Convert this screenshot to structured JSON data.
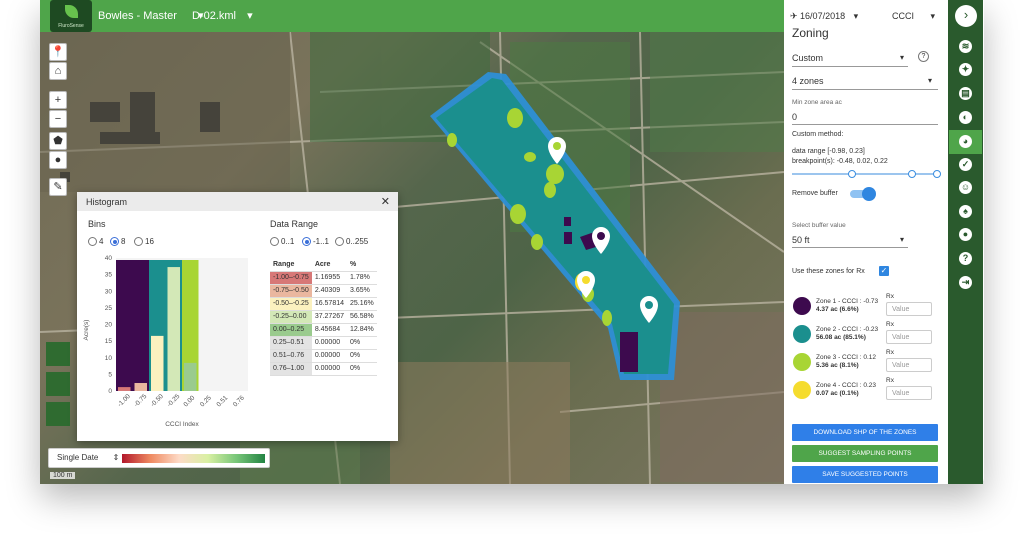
{
  "topbar": {
    "brand": "FluroSense",
    "farm": "Bowles - Master",
    "file": "D-02.kml",
    "farm_caret": "▾",
    "file_caret": "▾"
  },
  "map_controls": {
    "pin": "📍",
    "home": "⌂",
    "zoom_in": "+",
    "zoom_out": "−",
    "polygon": "⬟",
    "circle": "●",
    "cursor": "✎"
  },
  "histogram": {
    "title": "Histogram",
    "close": "✕",
    "bins_label": "Bins",
    "bins_options": [
      "4",
      "8",
      "16"
    ],
    "bins_selected": "8",
    "range_label": "Data Range",
    "range_options": [
      "0..1",
      "-1..1",
      "0..255"
    ],
    "range_selected": "-1..1",
    "y_axis_label": "Acre(s)",
    "x_axis_label": "CCCI Index",
    "y_ticks": [
      "40",
      "35",
      "30",
      "25",
      "20",
      "15",
      "10",
      "5",
      "0"
    ],
    "x_ticks": [
      "-1.00",
      "-0.75",
      "-0.50",
      "-0.25",
      "0.00",
      "0.25",
      "0.51",
      "0.76"
    ],
    "table": {
      "headers": [
        "Range",
        "Acre",
        "%"
      ],
      "rows": [
        {
          "range": "-1.00–-0.75",
          "acre": "1.16955",
          "pct": "1.78%",
          "color": "#d77877"
        },
        {
          "range": "-0.75–-0.50",
          "acre": "2.40309",
          "pct": "3.65%",
          "color": "#eab79f"
        },
        {
          "range": "-0.50–-0.25",
          "acre": "16.57814",
          "pct": "25.16%",
          "color": "#fbf1bf"
        },
        {
          "range": "-0.25–0.00",
          "acre": "37.27267",
          "pct": "56.58%",
          "color": "#d3e8b7"
        },
        {
          "range": "0.00–0.25",
          "acre": "8.45684",
          "pct": "12.84%",
          "color": "#9acb8e"
        },
        {
          "range": "0.25–0.51",
          "acre": "0.00000",
          "pct": "0%",
          "color": "#e3e3e3"
        },
        {
          "range": "0.51–0.76",
          "acre": "0.00000",
          "pct": "0%",
          "color": "#e3e3e3"
        },
        {
          "range": "0.76–1.00",
          "acre": "0.00000",
          "pct": "0%",
          "color": "#e3e3e3"
        }
      ]
    }
  },
  "legend": {
    "mode": "Single Date",
    "mode_caret": "⇕"
  },
  "scale": {
    "text": "100 m"
  },
  "panel": {
    "date": "16/07/2018",
    "date_caret": "▾",
    "index": "CCCI",
    "index_caret": "▾",
    "title": "Zoning",
    "method": "Custom",
    "method_caret": "▾",
    "help": "?",
    "zones_count": "4 zones",
    "zones_caret": "▾",
    "min_area_label": "Min zone area ac",
    "min_area_value": "0",
    "custom_method_label": "Custom method:",
    "data_range": "data range [-0.98, 0.23]",
    "breakpoints": "breakpoint(s): -0.48, 0.02, 0.22",
    "remove_buffer_label": "Remove buffer",
    "buffer_select_label": "Select buffer value",
    "buffer_value": "50 ft",
    "buffer_caret": "▾",
    "use_zones_label": "Use these zones for Rx",
    "rx_label": "Rx",
    "rx_placeholder": "Value",
    "zones": [
      {
        "name": "Zone 1",
        "ccci": "- CCCI : -0.73",
        "area": "4.37 ac (6.6%)",
        "color": "#3d0a4e"
      },
      {
        "name": "Zone 2",
        "ccci": "- CCCI : -0.23",
        "area": "56.08 ac (85.1%)",
        "color": "#1b8f8e"
      },
      {
        "name": "Zone 3",
        "ccci": "- CCCI : 0.12",
        "area": "5.36 ac (8.1%)",
        "color": "#a8d534"
      },
      {
        "name": "Zone 4",
        "ccci": "- CCCI : 0.23",
        "area": "0.07 ac (0.1%)",
        "color": "#f5dc2e"
      }
    ],
    "btn_download": "DOWNLOAD SHP OF THE ZONES",
    "btn_suggest": "SUGGEST SAMPLING POINTS",
    "btn_save": "SAVE SUGGESTED POINTS"
  },
  "rail": {
    "expand": "›",
    "icons": [
      "≋",
      "✦",
      "▤",
      "◐",
      "◕",
      "✓",
      "☺",
      "♠",
      "●",
      "?",
      "⇥"
    ]
  }
}
